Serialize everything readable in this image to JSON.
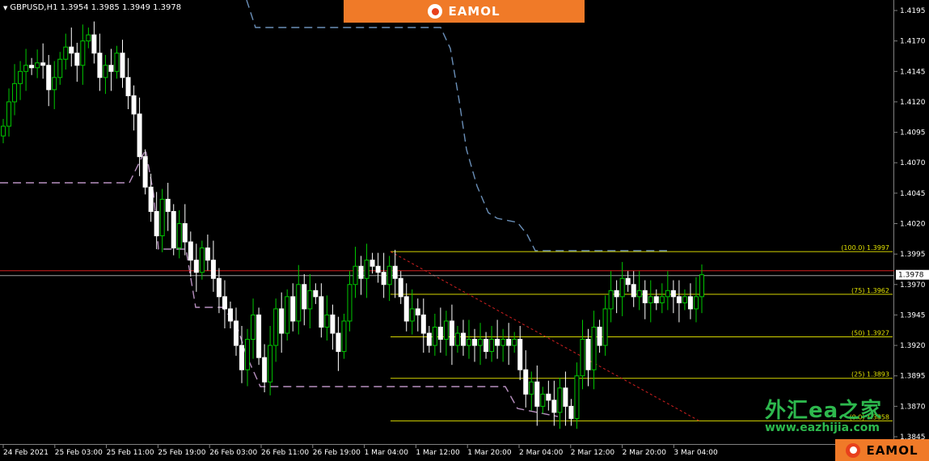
{
  "symbol_info": "GBPUSD,H1  1.3954 1.3985 1.3949 1.3978",
  "brand": {
    "top": "EAMOL",
    "bottom": "EAMOL"
  },
  "watermark": {
    "cn": "外汇ea之家",
    "url": "www.eazhijia.com"
  },
  "colors": {
    "bull": "#00c800",
    "bear": "#ffffff",
    "fib": "#d4d400",
    "trend": "#d42020",
    "bid": "#d42020",
    "upper_band": "#6a8fb8",
    "lower_band": "#b890c0",
    "accent": "#f07a28"
  },
  "chart_data": {
    "type": "candlestick",
    "price_axis": {
      "min": 1.3845,
      "max": 1.4195,
      "ticks": [
        "1.4195",
        "1.4170",
        "1.4145",
        "1.4120",
        "1.4095",
        "1.4070",
        "1.4045",
        "1.4020",
        "1.3995",
        "1.3970",
        "1.3945",
        "1.3920",
        "1.3895",
        "1.3870",
        "1.3845"
      ]
    },
    "current_price": "1.3978",
    "time_labels": [
      "24 Feb 2021",
      "25 Feb 03:00",
      "25 Feb 11:00",
      "25 Feb 19:00",
      "26 Feb 03:00",
      "26 Feb 11:00",
      "26 Feb 19:00",
      "1 Mar 04:00",
      "1 Mar 12:00",
      "1 Mar 20:00",
      "2 Mar 04:00",
      "2 Mar 12:00",
      "2 Mar 20:00",
      "3 Mar 04:00"
    ],
    "fib_levels": [
      {
        "label": "(100.0)  1.3997",
        "price": 1.3997
      },
      {
        "label": "(75)  1.3962",
        "price": 1.3962
      },
      {
        "label": "(50)  1.3927",
        "price": 1.3927
      },
      {
        "label": "(25)  1.3893",
        "price": 1.3893
      },
      {
        "label": "(0.0)  1.3858",
        "price": 1.3858
      }
    ],
    "closes": [
      1.41,
      1.412,
      1.4135,
      1.4145,
      1.415,
      1.4148,
      1.4152,
      1.415,
      1.413,
      1.414,
      1.4155,
      1.4165,
      1.416,
      1.415,
      1.417,
      1.4175,
      1.416,
      1.414,
      1.415,
      1.4145,
      1.416,
      1.414,
      1.4125,
      1.411,
      1.4075,
      1.405,
      1.403,
      1.401,
      1.404,
      1.403,
      1.4,
      1.402,
      1.4005,
      1.399,
      1.398,
      1.4,
      1.399,
      1.3975,
      1.396,
      1.395,
      1.394,
      1.392,
      1.39,
      1.3925,
      1.3945,
      1.391,
      1.389,
      1.392,
      1.395,
      1.393,
      1.396,
      1.394,
      1.397,
      1.395,
      1.3965,
      1.396,
      1.3935,
      1.3945,
      1.393,
      1.3915,
      1.394,
      1.397,
      1.3985,
      1.3975,
      1.399,
      1.3985,
      1.398,
      1.397,
      1.3985,
      1.3975,
      1.396,
      1.394,
      1.395,
      1.3945,
      1.393,
      1.392,
      1.3935,
      1.3925,
      1.394,
      1.392,
      1.393,
      1.392,
      1.3925,
      1.392,
      1.3925,
      1.3915,
      1.3925,
      1.392,
      1.3925,
      1.392,
      1.3925,
      1.39,
      1.388,
      1.389,
      1.387,
      1.388,
      1.3875,
      1.3865,
      1.3885,
      1.387,
      1.386,
      1.3895,
      1.3925,
      1.39,
      1.3935,
      1.392,
      1.395,
      1.3965,
      1.396,
      1.3975,
      1.397,
      1.396,
      1.3965,
      1.3955,
      1.396,
      1.3955,
      1.396,
      1.3965,
      1.396,
      1.3955,
      1.396,
      1.395,
      1.396,
      1.3978
    ]
  }
}
